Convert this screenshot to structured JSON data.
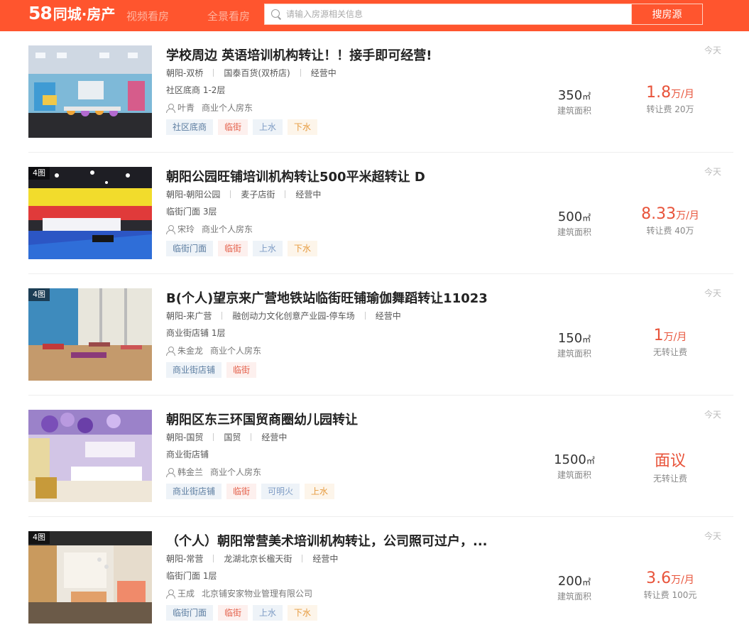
{
  "header": {
    "logo_num": "58",
    "logo_text": "同城·房产",
    "nav": [
      "视频看房",
      "全景看房"
    ],
    "search_placeholder": "请输入房源相关信息",
    "search_button": "搜房源"
  },
  "labels": {
    "area_label": "建筑面积",
    "area_unit": "㎡"
  },
  "listings": [
    {
      "pic_count": "",
      "title": "学校周边 英语培训机构转让！！接手即可经营!",
      "district": "朝阳-双桥",
      "location": "国泰百货(双桥店)",
      "status": "经营中",
      "type": "社区底商 1-2层",
      "person": "叶青",
      "role": "商业个人房东",
      "tags": [
        {
          "text": "社区底商",
          "style": "blue"
        },
        {
          "text": "临街",
          "style": "red"
        },
        {
          "text": "上水",
          "style": "lblue"
        },
        {
          "text": "下水",
          "style": "orange"
        }
      ],
      "area": "350",
      "price": "1.8",
      "price_unit": "万/月",
      "transfer": "转让费 20万",
      "date": "今天"
    },
    {
      "pic_count": "4图",
      "title": "朝阳公园旺铺培训机构转让500平米超转让 D",
      "district": "朝阳-朝阳公园",
      "location": "麦子店街",
      "status": "经营中",
      "type": "临街门面 3层",
      "person": "宋玲",
      "role": "商业个人房东",
      "tags": [
        {
          "text": "临街门面",
          "style": "blue"
        },
        {
          "text": "临街",
          "style": "red"
        },
        {
          "text": "上水",
          "style": "lblue"
        },
        {
          "text": "下水",
          "style": "orange"
        }
      ],
      "area": "500",
      "price": "8.33",
      "price_unit": "万/月",
      "transfer": "转让费 40万",
      "date": "今天"
    },
    {
      "pic_count": "4图",
      "title": "B(个人)望京来广营地铁站临街旺铺瑜伽舞蹈转让11023",
      "district": "朝阳-来广营",
      "location": "融创动力文化创意产业园-停车场",
      "status": "经营中",
      "type": "商业街店铺 1层",
      "person": "朱金龙",
      "role": "商业个人房东",
      "tags": [
        {
          "text": "商业街店铺",
          "style": "blue"
        },
        {
          "text": "临街",
          "style": "red"
        }
      ],
      "area": "150",
      "price": "1",
      "price_unit": "万/月",
      "transfer": "无转让费",
      "date": "今天"
    },
    {
      "pic_count": "",
      "title": "朝阳区东三环国贸商圈幼儿园转让",
      "district": "朝阳-国贸",
      "location": "国贸",
      "status": "经营中",
      "type": "商业街店铺",
      "person": "韩金兰",
      "role": "商业个人房东",
      "tags": [
        {
          "text": "商业街店铺",
          "style": "blue"
        },
        {
          "text": "临街",
          "style": "red"
        },
        {
          "text": "可明火",
          "style": "lblue"
        },
        {
          "text": "上水",
          "style": "orange"
        }
      ],
      "area": "1500",
      "price": "面议",
      "price_unit": "",
      "transfer": "无转让费",
      "date": "今天"
    },
    {
      "pic_count": "4图",
      "title": "（个人）朝阳常营美术培训机构转让，公司照可过户，...",
      "district": "朝阳-常营",
      "location": "龙湖北京长楹天街",
      "status": "经营中",
      "type": "临街门面 1层",
      "person": "王成",
      "role": "北京铺安家物业管理有限公司",
      "tags": [
        {
          "text": "临街门面",
          "style": "blue"
        },
        {
          "text": "临街",
          "style": "red"
        },
        {
          "text": "上水",
          "style": "lblue"
        },
        {
          "text": "下水",
          "style": "orange"
        }
      ],
      "area": "200",
      "price": "3.6",
      "price_unit": "万/月",
      "transfer": "转让费 100元",
      "date": "今天"
    }
  ]
}
